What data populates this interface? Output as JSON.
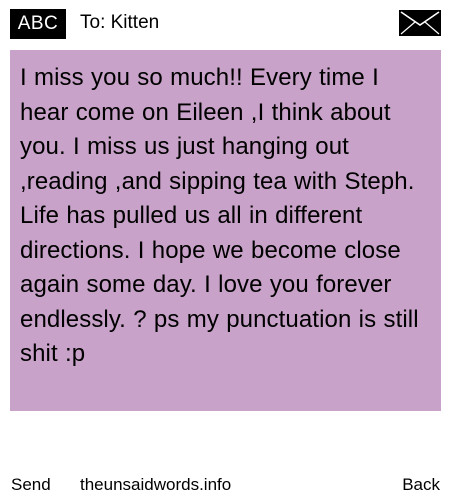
{
  "header": {
    "input_mode": "ABC",
    "recipient": "To: Kitten",
    "envelope_icon": "envelope-icon"
  },
  "message": {
    "body": "I miss you so much!! Every time I hear come on Eileen ,I think about you. I miss us just hanging out ,reading ,and sipping tea with Steph. Life has pulled us all in different directions.  I hope we become close again some day.  I love you forever endlessly. ? ps my punctuation is still shit :p",
    "background_color": "#c8a2c8"
  },
  "footer": {
    "send_label": "Send",
    "site_label": "theunsaidwords.info",
    "back_label": "Back"
  }
}
